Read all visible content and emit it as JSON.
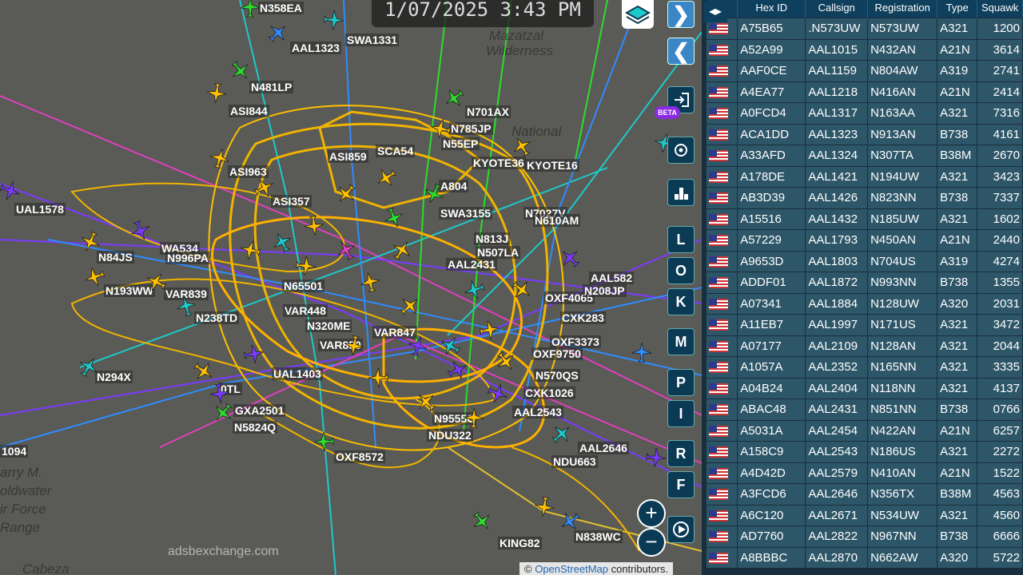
{
  "clock": {
    "text": "1/07/2025 3:43 PM"
  },
  "map": {
    "terrain_labels": [
      "Mazatzal",
      "Wilderness",
      "National",
      "arry M.",
      "oldwater",
      "ir Force",
      "Range",
      "Cabeza"
    ],
    "watermark": "adsbexchange.com",
    "attribution_prefix": "© ",
    "attribution_link": "OpenStreetMap",
    "attribution_suffix": " contributors.",
    "aircraft_labels": [
      "N358EA",
      "SWA1331",
      "AAL1323",
      "N481LP",
      "ASI844",
      "N701AX",
      "N785JP",
      "N55EP",
      "SCA54",
      "KYOTE36",
      "KYOTE16",
      "ASI859",
      "ASI963",
      "ASI357",
      "UAL1578",
      "N84JS",
      "WA534",
      "N996PA",
      "N193WW",
      "VAR839",
      "N238TD",
      "N65501",
      "VAR448",
      "N320ME",
      "VAR850",
      "VAR847",
      "UAL1403",
      "N294X",
      "GXA2501",
      "N5824Q",
      "OXF8572",
      "N9555C",
      "NDU322",
      "AAL2543",
      "CXK1026",
      "N570QS",
      "OXF9750",
      "OXF3373",
      "CXK283",
      "OXF4065",
      "AAL582",
      "N208JP",
      "N813J",
      "N507LA",
      "AAL2431",
      "A804",
      "SWA3155",
      "N7027V",
      "N610AM",
      "AAL2646",
      "NDU663",
      "KING82",
      "N838WC",
      "1094",
      "0TL"
    ],
    "beta_badge": "BETA"
  },
  "controls": {
    "forward_arrow": "❯",
    "back_arrow": "❮",
    "letters": [
      "L",
      "O",
      "K",
      "M",
      "P",
      "I",
      "R",
      "F"
    ],
    "zoom_in": "+",
    "zoom_out": "−"
  },
  "panel": {
    "toggle_label": "◂▸",
    "columns": [
      "Hex ID",
      "Callsign",
      "Registration",
      "Type",
      "Squawk"
    ],
    "rows": [
      [
        "A75B65",
        ".N573UW",
        "N573UW",
        "A321",
        "1200"
      ],
      [
        "A52A99",
        "AAL1015",
        "N432AN",
        "A21N",
        "3614"
      ],
      [
        "AAF0CE",
        "AAL1159",
        "N804AW",
        "A319",
        "2741"
      ],
      [
        "A4EA77",
        "AAL1218",
        "N416AN",
        "A21N",
        "2414"
      ],
      [
        "A0FCD4",
        "AAL1317",
        "N163AA",
        "A321",
        "7316"
      ],
      [
        "ACA1DD",
        "AAL1323",
        "N913AN",
        "B738",
        "4161"
      ],
      [
        "A33AFD",
        "AAL1324",
        "N307TA",
        "B38M",
        "2670"
      ],
      [
        "A178DE",
        "AAL1421",
        "N194UW",
        "A321",
        "3423"
      ],
      [
        "AB3D39",
        "AAL1426",
        "N823NN",
        "B738",
        "7337"
      ],
      [
        "A15516",
        "AAL1432",
        "N185UW",
        "A321",
        "1602"
      ],
      [
        "A57229",
        "AAL1793",
        "N450AN",
        "A21N",
        "2440"
      ],
      [
        "A9653D",
        "AAL1803",
        "N704US",
        "A319",
        "4274"
      ],
      [
        "ADDF01",
        "AAL1872",
        "N993NN",
        "B738",
        "1355"
      ],
      [
        "A07341",
        "AAL1884",
        "N128UW",
        "A320",
        "2031"
      ],
      [
        "A11EB7",
        "AAL1997",
        "N171US",
        "A321",
        "3472"
      ],
      [
        "A07177",
        "AAL2109",
        "N128AN",
        "A321",
        "2044"
      ],
      [
        "A1057A",
        "AAL2352",
        "N165NN",
        "A321",
        "3335"
      ],
      [
        "A04B24",
        "AAL2404",
        "N118NN",
        "A321",
        "4137"
      ],
      [
        "ABAC48",
        "AAL2431",
        "N851NN",
        "B738",
        "0766"
      ],
      [
        "A5031A",
        "AAL2454",
        "N422AN",
        "A21N",
        "6257"
      ],
      [
        "A158C9",
        "AAL2543",
        "N186US",
        "A321",
        "2272"
      ],
      [
        "A4D42D",
        "AAL2579",
        "N410AN",
        "A21N",
        "1522"
      ],
      [
        "A3FCD6",
        "AAL2646",
        "N356TX",
        "B38M",
        "4563"
      ],
      [
        "A6C120",
        "AAL2671",
        "N534UW",
        "A321",
        "4560"
      ],
      [
        "AD7760",
        "AAL2822",
        "N967NN",
        "B738",
        "6666"
      ],
      [
        "A8BBBC",
        "AAL2870",
        "N662AW",
        "A320",
        "5722"
      ]
    ]
  }
}
